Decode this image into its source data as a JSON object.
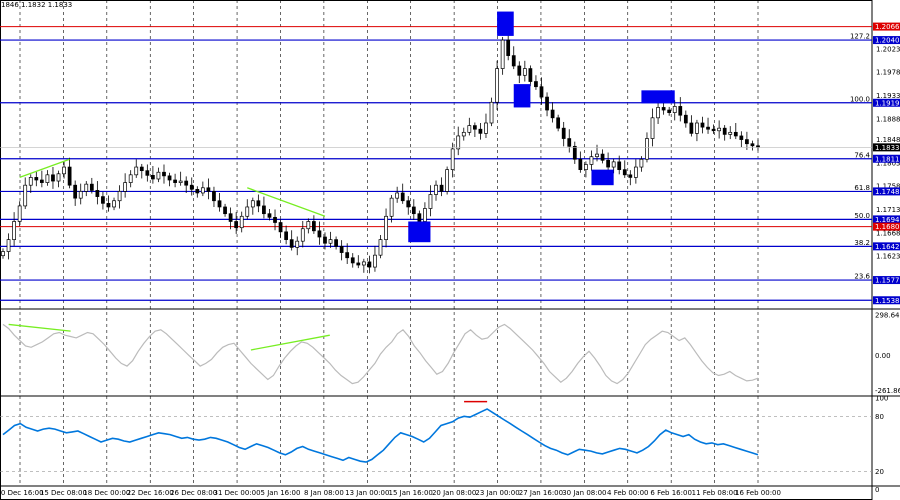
{
  "header": {
    "ohlc_text": "1846 1.1832 1.1833"
  },
  "colors": {
    "bull": "#000000",
    "fib": "#0000cc",
    "red_level": "#dd0000",
    "box": "#0000ee",
    "trend": "#77ee22",
    "cci": "#bbbbbb",
    "rsi": "#0077dd",
    "price_tag": "#000000",
    "axis_text": "#000000"
  },
  "chart_data": [
    {
      "type": "line",
      "name": "price",
      "ylim": [
        1.1525,
        1.2098
      ],
      "x": [
        "10 Dec 16:00",
        "15 Dec 08:00",
        "18 Dec 00:00",
        "22 Dec 16:00",
        "26 Dec 08:00",
        "31 Dec 00:00",
        "5 Jan 16:00",
        "8 Jan 08:00",
        "13 Jan 00:00",
        "15 Jan 16:00",
        "20 Jan 08:00",
        "23 Jan 00:00",
        "27 Jan 16:00",
        "30 Jan 08:00",
        "4 Feb 00:00",
        "6 Feb 16:00",
        "11 Feb 08:00",
        "16 Feb 00:00"
      ],
      "y_ticks": [
        1.2023,
        1.1978,
        1.1933,
        1.1888,
        1.1848,
        1.1803,
        1.1758,
        1.1713,
        1.1668,
        1.1623
      ],
      "levels": [
        {
          "value": 1.2066,
          "label": "1.2066",
          "pct": "",
          "kind": "red"
        },
        {
          "value": 1.204,
          "label": "1.2040",
          "pct": "127.2",
          "kind": "fib"
        },
        {
          "value": 1.1919,
          "label": "1.1919",
          "pct": "100.0",
          "kind": "fib"
        },
        {
          "value": 1.1811,
          "label": "1.1811",
          "pct": "76.4",
          "kind": "fib"
        },
        {
          "value": 1.1748,
          "label": "1.1748",
          "pct": "61.8",
          "kind": "fib"
        },
        {
          "value": 1.1694,
          "label": "1.1694",
          "pct": "50.0",
          "kind": "fib"
        },
        {
          "value": 1.168,
          "label": "1.1680",
          "pct": "",
          "kind": "red"
        },
        {
          "value": 1.1642,
          "label": "1.1642",
          "pct": "38.2",
          "kind": "fib"
        },
        {
          "value": 1.1577,
          "label": "1.1577",
          "pct": "23.6",
          "kind": "fib"
        },
        {
          "value": 1.1538,
          "label": "1.1538",
          "pct": "",
          "kind": "fib"
        }
      ],
      "current_price": {
        "value": 1.1833,
        "label": "1.1833"
      },
      "closes": [
        1.1632,
        1.1655,
        1.169,
        1.172,
        1.176,
        1.1775,
        1.177,
        1.1765,
        1.178,
        1.1768,
        1.1782,
        1.1795,
        1.176,
        1.1735,
        1.1748,
        1.1762,
        1.175,
        1.1738,
        1.1725,
        1.1718,
        1.173,
        1.1748,
        1.1765,
        1.178,
        1.1795,
        1.1788,
        1.1779,
        1.1772,
        1.1785,
        1.1778,
        1.177,
        1.1765,
        1.1768,
        1.176,
        1.1752,
        1.1745,
        1.1755,
        1.1748,
        1.173,
        1.1718,
        1.1705,
        1.169,
        1.1678,
        1.17,
        1.1718,
        1.173,
        1.172,
        1.1705,
        1.1698,
        1.1688,
        1.167,
        1.1655,
        1.164,
        1.1652,
        1.1676,
        1.169,
        1.1672,
        1.166,
        1.1648,
        1.1655,
        1.1642,
        1.163,
        1.162,
        1.161,
        1.1606,
        1.1612,
        1.1602,
        1.1625,
        1.1655,
        1.17,
        1.1735,
        1.1745,
        1.173,
        1.1718,
        1.1705,
        1.169,
        1.1715,
        1.1742,
        1.176,
        1.1748,
        1.179,
        1.183,
        1.1855,
        1.1862,
        1.1875,
        1.1868,
        1.186,
        1.188,
        1.192,
        1.1985,
        1.204,
        1.201,
        1.199,
        1.1972,
        1.1985,
        1.196,
        1.195,
        1.193,
        1.1905,
        1.189,
        1.187,
        1.185,
        1.1835,
        1.181,
        1.179,
        1.18,
        1.1815,
        1.182,
        1.1808,
        1.1795,
        1.1805,
        1.179,
        1.178,
        1.1775,
        1.1795,
        1.181,
        1.185,
        1.189,
        1.191,
        1.1905,
        1.19,
        1.1912,
        1.1895,
        1.188,
        1.186,
        1.188,
        1.1872,
        1.1868,
        1.1865,
        1.187,
        1.1858,
        1.1862,
        1.1855,
        1.1848,
        1.184,
        1.1836,
        1.1833
      ]
    },
    {
      "type": "line",
      "name": "oscillator-1",
      "ylim": [
        -295,
        330
      ],
      "y_ticks": [
        298.6486,
        0.0,
        -261.864
      ],
      "y_tick_labels": [
        "298.6486",
        "0.00",
        "-261.864"
      ],
      "values": [
        230,
        200,
        150,
        110,
        70,
        60,
        80,
        100,
        130,
        160,
        170,
        150,
        140,
        130,
        150,
        170,
        160,
        120,
        80,
        30,
        -20,
        -60,
        -80,
        -40,
        30,
        90,
        140,
        180,
        190,
        160,
        120,
        80,
        40,
        0,
        -40,
        -80,
        -60,
        -30,
        20,
        60,
        80,
        90,
        40,
        -10,
        -60,
        -100,
        -140,
        -180,
        -150,
        -80,
        -20,
        30,
        70,
        100,
        90,
        60,
        20,
        -20,
        -60,
        -110,
        -150,
        -180,
        -210,
        -200,
        -160,
        -110,
        -60,
        10,
        60,
        100,
        160,
        190,
        140,
        70,
        20,
        -40,
        -90,
        -140,
        -120,
        -60,
        20,
        90,
        160,
        190,
        150,
        120,
        130,
        170,
        210,
        230,
        200,
        160,
        120,
        80,
        40,
        -10,
        -60,
        -120,
        -160,
        -200,
        -170,
        -120,
        -60,
        -10,
        30,
        -20,
        -80,
        -150,
        -190,
        -210,
        -180,
        -130,
        -60,
        10,
        80,
        120,
        150,
        180,
        170,
        140,
        110,
        130,
        80,
        20,
        -40,
        -90,
        -130,
        -150,
        -140,
        -120,
        -150,
        -170,
        -190,
        -185,
        -170
      ]
    },
    {
      "type": "line",
      "name": "oscillator-2",
      "ylim": [
        5,
        100
      ],
      "y_ticks": [
        100,
        80,
        20,
        0
      ],
      "y_tick_labels": [
        "100",
        "80",
        "20",
        "0"
      ],
      "values": [
        60,
        65,
        70,
        72,
        68,
        66,
        64,
        66,
        67,
        66,
        64,
        62,
        63,
        64,
        61,
        58,
        55,
        52,
        54,
        56,
        55,
        53,
        52,
        54,
        56,
        58,
        60,
        62,
        61,
        60,
        58,
        56,
        57,
        55,
        54,
        55,
        57,
        56,
        54,
        52,
        49,
        46,
        44,
        47,
        50,
        48,
        46,
        43,
        40,
        38,
        41,
        45,
        47,
        44,
        42,
        40,
        38,
        36,
        34,
        32,
        35,
        33,
        31,
        30,
        33,
        38,
        43,
        50,
        57,
        62,
        60,
        58,
        55,
        52,
        56,
        63,
        70,
        72,
        74,
        78,
        80,
        79,
        82,
        85,
        88,
        84,
        80,
        76,
        72,
        68,
        64,
        60,
        56,
        52,
        48,
        45,
        43,
        40,
        38,
        41,
        44,
        43,
        42,
        40,
        39,
        41,
        43,
        45,
        44,
        42,
        40,
        43,
        47,
        53,
        60,
        65,
        62,
        60,
        58,
        60,
        55,
        52,
        50,
        51,
        49,
        50,
        48,
        46,
        44,
        42,
        40,
        38
      ]
    }
  ],
  "markers": [
    {
      "label": "",
      "kind": "resistance",
      "value": 82
    }
  ]
}
